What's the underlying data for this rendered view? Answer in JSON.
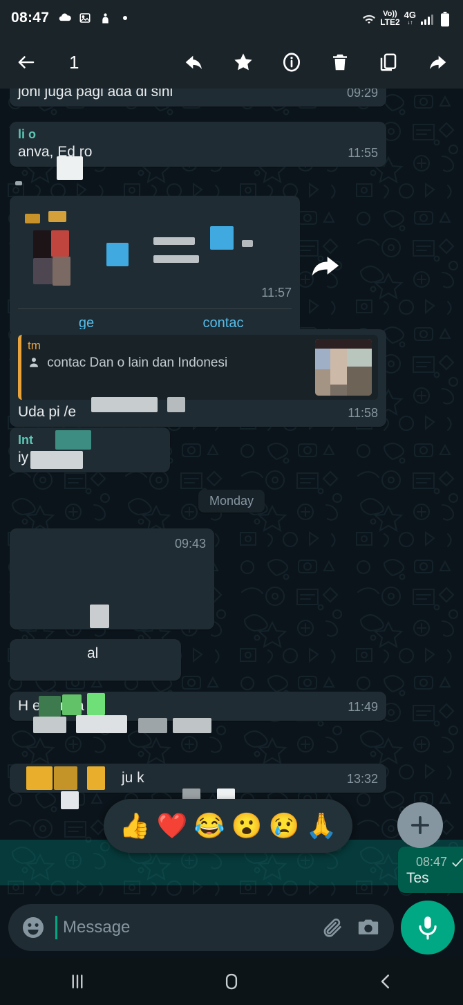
{
  "status_bar": {
    "time": "08:47",
    "left_icons": [
      "cloud-icon",
      "image-icon",
      "download-icon",
      "dot-icon"
    ],
    "network": {
      "volte_top": "Vo))",
      "volte_bottom": "LTE2",
      "generation": "4G",
      "data_arrows": "↓↑"
    },
    "right_icons": [
      "wifi-icon",
      "signal-icon",
      "battery-icon"
    ]
  },
  "toolbar": {
    "back_label": "back-arrow",
    "selected_count": "1",
    "actions": [
      {
        "name": "reply-button",
        "icon": "reply-icon"
      },
      {
        "name": "star-button",
        "icon": "star-icon"
      },
      {
        "name": "info-button",
        "icon": "info-icon"
      },
      {
        "name": "delete-button",
        "icon": "trash-icon"
      },
      {
        "name": "copy-button",
        "icon": "copy-icon"
      },
      {
        "name": "forward-button",
        "icon": "forward-icon"
      }
    ]
  },
  "messages": [
    {
      "id": "m1",
      "dir": "in",
      "text": "joni juga pagi ada di sini",
      "time": "09:29",
      "redacted": true
    },
    {
      "id": "m2",
      "dir": "in",
      "sender": "li           o",
      "text": "anva,                 Ed          ro",
      "time": "11:55",
      "redacted": true
    },
    {
      "id": "m3",
      "dir": "in",
      "text": "",
      "time": "11:57",
      "redacted": true,
      "link_buttons": [
        "ge",
        "contac"
      ],
      "has_forward_icon": true
    },
    {
      "id": "m4",
      "dir": "in",
      "time": "11:58",
      "redacted": true,
      "quote": {
        "name": "tm",
        "body": "contac        Dan            o      lain dan Indonesi",
        "thumbnail": "photo-thumbnail"
      },
      "text": "Uda  pi        /e"
    },
    {
      "id": "m5",
      "dir": "in",
      "sender": "Int",
      "text": "iy         u t       2",
      "time": "",
      "redacted": true
    },
    {
      "id": "m6",
      "dir": "in",
      "text": "",
      "time": "09:43",
      "redacted": true
    },
    {
      "id": "m7",
      "dir": "in",
      "text": "al",
      "time": "",
      "redacted": true
    },
    {
      "id": "m8",
      "dir": "in",
      "text": "H        en        i        nga      al",
      "time": "11:49",
      "redacted": true
    },
    {
      "id": "m9",
      "dir": "in",
      "text": "ju k",
      "time": "13:32",
      "redacted": true
    },
    {
      "id": "m10",
      "dir": "out",
      "text": "Tes",
      "time": "08:47",
      "status": "sent-check",
      "selected": true
    }
  ],
  "day_divider": {
    "label": "Monday"
  },
  "reaction_bar": {
    "emojis": [
      "👍",
      "❤️",
      "😂",
      "😮",
      "😢",
      "🙏"
    ],
    "more_label": "+"
  },
  "composer": {
    "placeholder": "Message",
    "value": "",
    "emoji_icon": "smiley-icon",
    "attach_icon": "paperclip-icon",
    "camera_icon": "camera-icon",
    "mic_icon": "microphone-icon"
  },
  "nav_bar": {
    "recents_label": "|||",
    "home_label": "O",
    "back_label": "<"
  },
  "colors": {
    "app_bg": "#0b141a",
    "bar_bg": "#1b2429",
    "incoming_bubble": "#202c33",
    "outgoing_bubble": "#005c4b",
    "accent_green": "#00a884",
    "link_blue": "#53bdeb",
    "quote_orange": "#e8a33d",
    "meta_text": "#8696a0",
    "selection_overlay": "rgba(0,150,136,.30)"
  }
}
